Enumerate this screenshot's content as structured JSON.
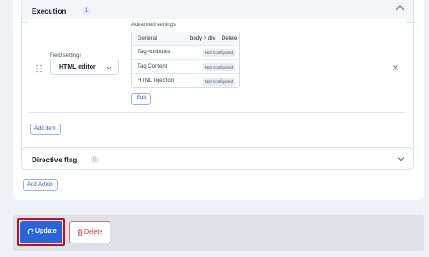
{
  "execution": {
    "title": "Execution",
    "count": "1"
  },
  "item": {
    "field_settings_label": "Field settings",
    "field_type": "HTML editor",
    "advanced_settings_label": "Advanced settings",
    "advanced_table": {
      "header": {
        "name": "General",
        "value": "body > div",
        "action": "Delete"
      },
      "rows": [
        {
          "name": "Tag Attributes",
          "status": "Not Configured"
        },
        {
          "name": "Tag Content",
          "status": "Not Configured"
        },
        {
          "name": "HTML Injection",
          "status": "Not Configured"
        }
      ]
    },
    "edit_label": "Edit"
  },
  "add_item_label": "Add item",
  "directive": {
    "title": "Directive flag",
    "count": "0"
  },
  "add_action_label": "Add Action",
  "footer": {
    "update_label": "Update",
    "delete_label": "Delete"
  },
  "colors": {
    "primary": "#2b63d9",
    "danger": "#d43a3a",
    "highlight": "#c1121f"
  }
}
